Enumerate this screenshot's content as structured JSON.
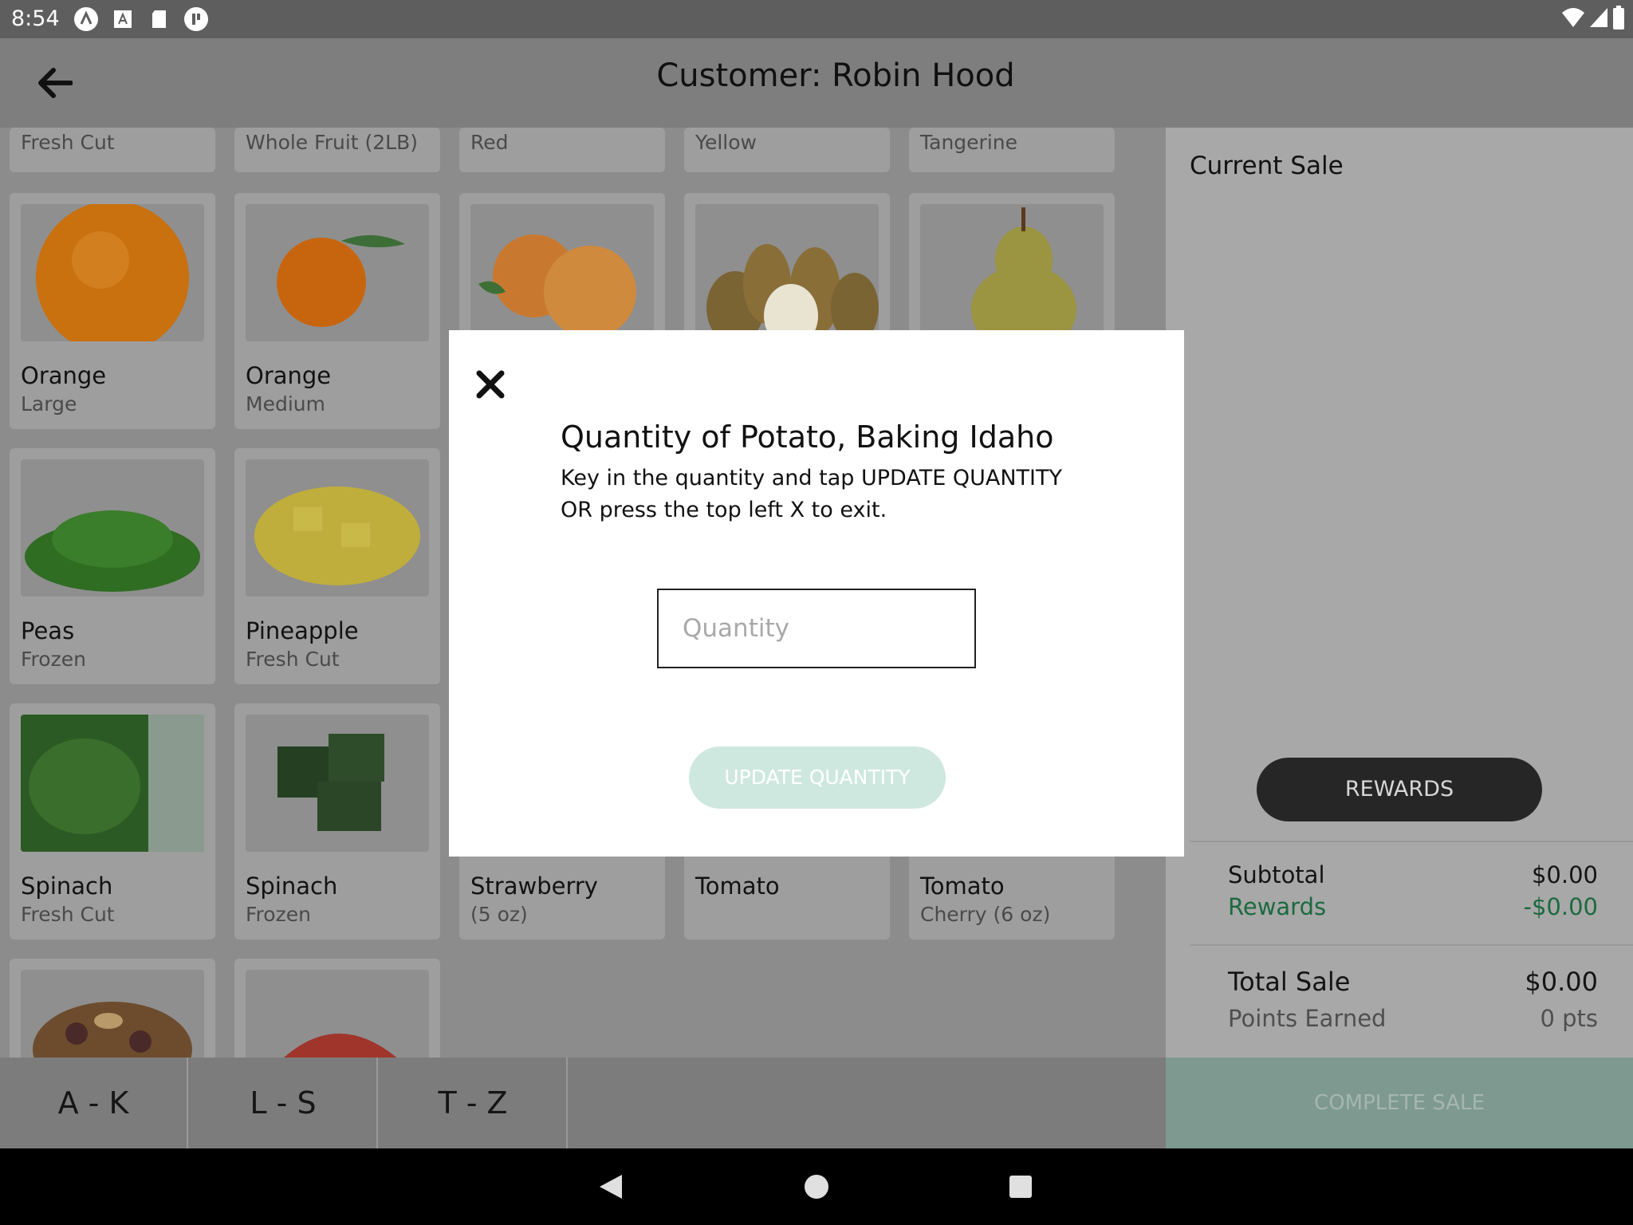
{
  "status_bar": {
    "time": "8:54"
  },
  "header": {
    "title": "Customer: Robin Hood"
  },
  "products_top_row": [
    {
      "sub": "Fresh Cut"
    },
    {
      "sub": "Whole Fruit (2LB)"
    },
    {
      "sub": "Red"
    },
    {
      "sub": "Yellow"
    },
    {
      "sub": "Tangerine"
    }
  ],
  "products": [
    {
      "name": "Orange",
      "sub": "Large"
    },
    {
      "name": "Orange",
      "sub": "Medium"
    },
    {
      "name": "Peas",
      "sub": "Frozen"
    },
    {
      "name": "Pineapple",
      "sub": "Fresh Cut"
    },
    {
      "name": "Spinach",
      "sub": "Fresh Cut"
    },
    {
      "name": "Spinach",
      "sub": "Frozen"
    },
    {
      "name": "Strawberry",
      "sub": "(5 oz)"
    },
    {
      "name": "Tomato",
      "sub": ""
    },
    {
      "name": "Tomato",
      "sub": "Cherry (6 oz)"
    }
  ],
  "letter_tabs": [
    "A - K",
    "L - S",
    "T - Z"
  ],
  "sale_panel": {
    "title": "Current Sale",
    "rewards_button": "REWARDS",
    "subtotal_label": "Subtotal",
    "subtotal_value": "$0.00",
    "rewards_label": "Rewards",
    "rewards_value": "-$0.00",
    "total_label": "Total Sale",
    "total_value": "$0.00",
    "points_label": "Points Earned",
    "points_value": "0 pts",
    "complete_button": "COMPLETE SALE"
  },
  "modal": {
    "title": "Quantity of Potato, Baking Idaho",
    "line1": "Key in the quantity and tap UPDATE QUANTITY",
    "line2": "OR press the top left X to exit.",
    "input_placeholder": "Quantity",
    "input_value": "",
    "update_button": "UPDATE QUANTITY"
  },
  "colors": {
    "accent_green": "#1c6a40",
    "update_button_bg": "#cfe8df",
    "rewards_button_bg": "#262626"
  }
}
